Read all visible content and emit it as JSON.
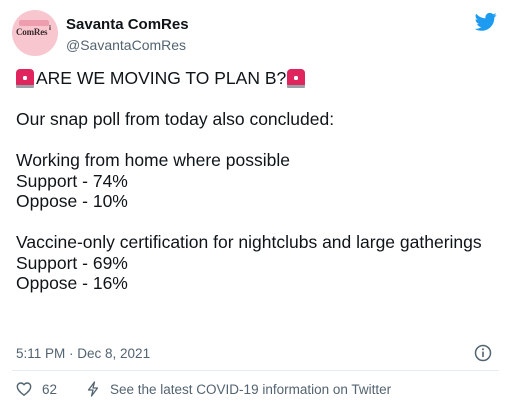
{
  "account": {
    "display_name": "Savanta ComRes",
    "handle": "@SavantaComRes",
    "avatar_text": "ComRes"
  },
  "tweet": {
    "headline": "ARE WE MOVING TO PLAN B?",
    "lines": [
      "Our snap poll from today also concluded:",
      "Working from home where possible",
      "Support - 74%",
      "Oppose - 10%",
      "Vaccine-only certification for nightclubs and large gatherings",
      "Support - 69%",
      "Oppose - 16%"
    ]
  },
  "meta": {
    "timestamp": "5:11 PM · Dec 8, 2021"
  },
  "actions": {
    "like_count": "62",
    "covid_link": "See the latest COVID-19 information on Twitter"
  },
  "icons": {
    "brand": "twitter-bird-icon",
    "siren": "rotating-light-icon",
    "info": "info-icon",
    "heart": "heart-icon",
    "bolt": "bolt-icon"
  },
  "colors": {
    "twitter_blue": "#1d9bf0",
    "text": "#0f1419",
    "secondary": "#536471",
    "avatar_bg": "#f7c6cf"
  }
}
